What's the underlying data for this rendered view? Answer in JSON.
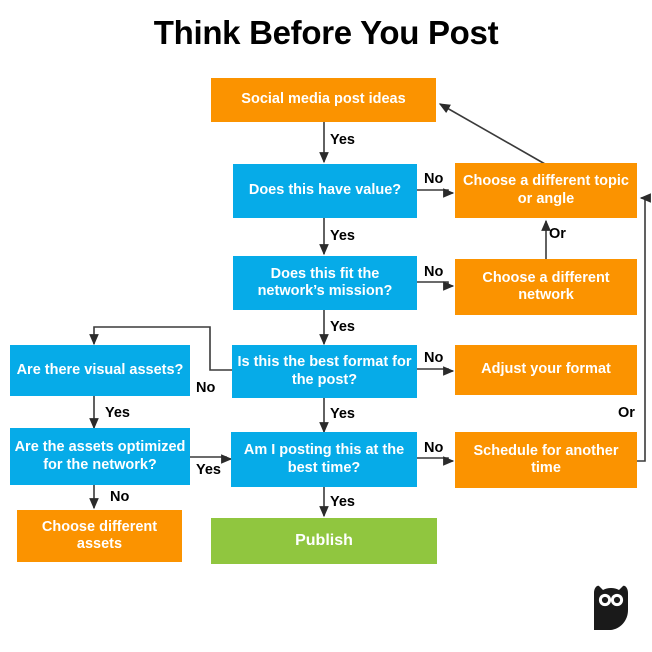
{
  "title": "Think Before You Post",
  "colors": {
    "orange": "#fb9300",
    "blue": "#06abe8",
    "green": "#90c63f",
    "text_on_node": "#ffffff",
    "label": "#000000",
    "background": "#ffffff"
  },
  "nodes": {
    "start": {
      "label": "Social media post ideas",
      "type": "start",
      "color": "orange"
    },
    "q_value": {
      "label": "Does this have value?",
      "type": "decision",
      "color": "blue"
    },
    "q_mission": {
      "label": "Does this fit the network’s mission?",
      "type": "decision",
      "color": "blue"
    },
    "q_format": {
      "label": "Is this the best format for the post?",
      "type": "decision",
      "color": "blue"
    },
    "q_time": {
      "label": "Am I posting this at the best time?",
      "type": "decision",
      "color": "blue"
    },
    "publish": {
      "label": "Publish",
      "type": "end",
      "color": "green"
    },
    "a_topic": {
      "label": "Choose a different topic or angle",
      "type": "action",
      "color": "orange"
    },
    "a_network": {
      "label": "Choose a different network",
      "type": "action",
      "color": "orange"
    },
    "a_adjust": {
      "label": "Adjust your format",
      "type": "action",
      "color": "orange"
    },
    "a_schedule": {
      "label": "Schedule for another time",
      "type": "action",
      "color": "orange"
    },
    "q_visual": {
      "label": "Are there visual assets?",
      "type": "decision",
      "color": "blue"
    },
    "q_optimized": {
      "label": "Are the assets optimized for the network?",
      "type": "decision",
      "color": "blue"
    },
    "a_assets": {
      "label": "Choose different assets",
      "type": "action",
      "color": "orange"
    }
  },
  "edge_labels": {
    "start_yes": "Yes",
    "value_no": "No",
    "value_yes": "Yes",
    "mission_no": "No",
    "mission_yes": "Yes",
    "topic_or": "Or",
    "format_no": "No",
    "format_yes": "Yes",
    "visual_no": "No",
    "visual_yes": "Yes",
    "optimized_yes": "Yes",
    "optimized_no": "No",
    "time_no": "No",
    "time_yes": "Yes",
    "schedule_or": "Or"
  },
  "logo": {
    "name": "hootsuite-owl-logo"
  }
}
